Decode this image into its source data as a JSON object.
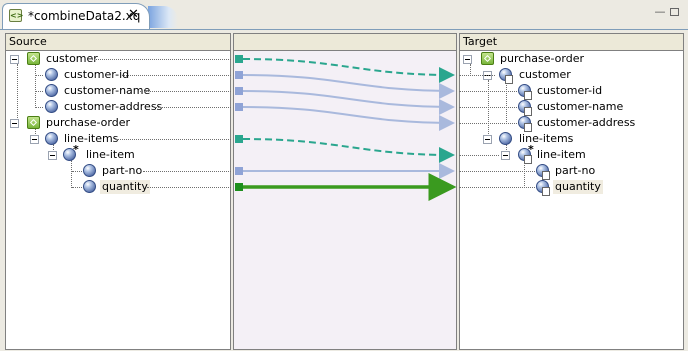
{
  "editor_tab": {
    "title": "*combineData2.xq",
    "icon": "xquery-file-icon",
    "close_icon": "close-icon"
  },
  "window_controls": {
    "minimize": "minimize-icon",
    "maximize": "maximize-icon"
  },
  "source_pane": {
    "header": "Source",
    "nodes": [
      {
        "label": "customer",
        "icon": "schema-icon"
      },
      {
        "label": "customer-id",
        "icon": "element-icon"
      },
      {
        "label": "customer-name",
        "icon": "element-icon"
      },
      {
        "label": "customer-address",
        "icon": "element-icon"
      },
      {
        "label": "purchase-order",
        "icon": "schema-icon"
      },
      {
        "label": "line-items",
        "icon": "element-icon"
      },
      {
        "label": "line-item",
        "icon": "repeating-element-icon"
      },
      {
        "label": "part-no",
        "icon": "element-icon"
      },
      {
        "label": "quantity",
        "icon": "element-icon"
      }
    ]
  },
  "mapping_pane": {
    "header": ""
  },
  "target_pane": {
    "header": "Target",
    "nodes": [
      {
        "label": "purchase-order",
        "icon": "schema-icon"
      },
      {
        "label": "customer",
        "icon": "element-icon"
      },
      {
        "label": "customer-id",
        "icon": "mapped-element-icon"
      },
      {
        "label": "customer-name",
        "icon": "mapped-element-icon"
      },
      {
        "label": "customer-address",
        "icon": "mapped-element-icon"
      },
      {
        "label": "line-items",
        "icon": "element-icon"
      },
      {
        "label": "line-item",
        "icon": "repeating-element-icon"
      },
      {
        "label": "part-no",
        "icon": "mapped-element-icon"
      },
      {
        "label": "quantity",
        "icon": "mapped-element-icon"
      }
    ]
  },
  "connection_colors": {
    "value_map": "#a9b9dd",
    "structural_map": "#2aa68e",
    "selected_map": "#3a9a1f"
  }
}
